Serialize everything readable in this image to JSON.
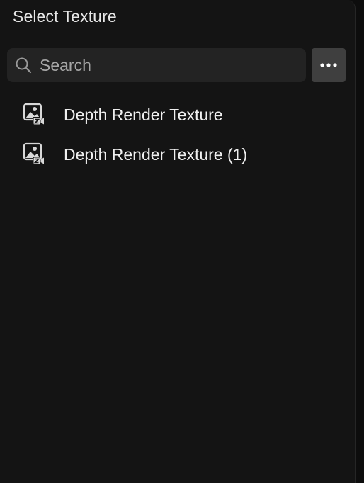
{
  "panel": {
    "title": "Select Texture"
  },
  "search": {
    "icon": "search-icon",
    "placeholder": "Search",
    "value": ""
  },
  "more_button": {
    "icon": "more-horizontal-icon"
  },
  "items": [
    {
      "label": "Depth Render Texture",
      "icon": "depth-render-texture-icon"
    },
    {
      "label": "Depth Render Texture (1)",
      "icon": "depth-render-texture-icon"
    }
  ],
  "colors": {
    "panel_bg": "#141414",
    "search_bg": "#232323",
    "button_bg": "#3f3f3f",
    "text": "#f0f0f0",
    "muted_text": "#a6a6a6"
  }
}
